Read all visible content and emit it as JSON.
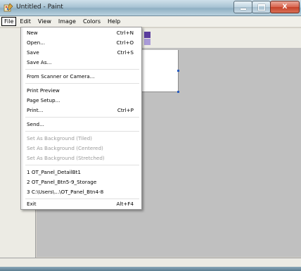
{
  "window": {
    "title": "Untitled - Paint",
    "caption_buttons": {
      "close": "X"
    }
  },
  "menubar": {
    "items": [
      "File",
      "Edit",
      "View",
      "Image",
      "Colors",
      "Help"
    ]
  },
  "file_menu": {
    "items": [
      {
        "label": "New",
        "shortcut": "Ctrl+N",
        "enabled": true
      },
      {
        "label": "Open...",
        "shortcut": "Ctrl+O",
        "enabled": true
      },
      {
        "label": "Save",
        "shortcut": "Ctrl+S",
        "enabled": true
      },
      {
        "label": "Save As...",
        "shortcut": "",
        "enabled": true
      },
      {
        "label": "From Scanner or Camera...",
        "shortcut": "",
        "enabled": true
      },
      {
        "label": "Print Preview",
        "shortcut": "",
        "enabled": true
      },
      {
        "label": "Page Setup...",
        "shortcut": "",
        "enabled": true
      },
      {
        "label": "Print...",
        "shortcut": "Ctrl+P",
        "enabled": true
      },
      {
        "label": "Send...",
        "shortcut": "",
        "enabled": true
      },
      {
        "label": "Set As Background (Tiled)",
        "shortcut": "",
        "enabled": false
      },
      {
        "label": "Set As Background (Centered)",
        "shortcut": "",
        "enabled": false
      },
      {
        "label": "Set As Background (Stretched)",
        "shortcut": "",
        "enabled": false
      },
      {
        "label": "1 OT_Panel_DetailBt1",
        "shortcut": "",
        "enabled": true
      },
      {
        "label": "2 OT_Panel_Btn5-9_Storage",
        "shortcut": "",
        "enabled": true
      },
      {
        "label": "3 C:\\Users\\...\\OT_Panel_Btn4-8",
        "shortcut": "",
        "enabled": true
      },
      {
        "label": "Exit",
        "shortcut": "Alt+F4",
        "enabled": true
      }
    ]
  },
  "colors": {
    "accent": "#5b3d9e",
    "swatch_light": "#a99ad8",
    "workspace": "#c0c0c0"
  }
}
